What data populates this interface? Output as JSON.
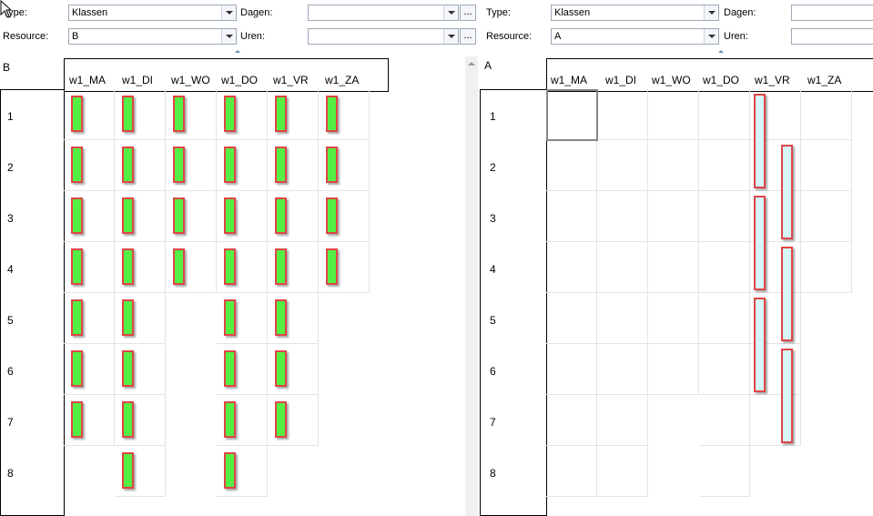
{
  "left": {
    "filters": {
      "type_label": "Type:",
      "type_value": "Klassen",
      "resource_label": "Resource:",
      "resource_value": "B",
      "dagen_label": "Dagen:",
      "dagen_value": "",
      "uren_label": "Uren:",
      "uren_value": "",
      "ellipsis": "..."
    },
    "corner": "B",
    "columns": [
      "w1_MA",
      "w1_DI",
      "w1_WO",
      "w1_DO",
      "w1_VR",
      "w1_ZA"
    ],
    "rows": [
      "1",
      "2",
      "3",
      "4",
      "5",
      "6",
      "7",
      "8"
    ]
  },
  "right": {
    "filters": {
      "type_label": "Type:",
      "type_value": "Klassen",
      "resource_label": "Resource:",
      "resource_value": "A",
      "dagen_label": "Dagen:",
      "dagen_value": "",
      "uren_label": "Uren:",
      "uren_value": ""
    },
    "corner": "A",
    "columns": [
      "w1_MA",
      "w1_DI",
      "w1_WO",
      "w1_DO",
      "w1_VR",
      "w1_ZA"
    ],
    "rows": [
      "1",
      "2",
      "3",
      "4",
      "5",
      "6",
      "7",
      "8"
    ]
  },
  "colors": {
    "green_block": "#55ee44",
    "cyan_block": "#d6f5f5",
    "block_border": "#e04545"
  }
}
